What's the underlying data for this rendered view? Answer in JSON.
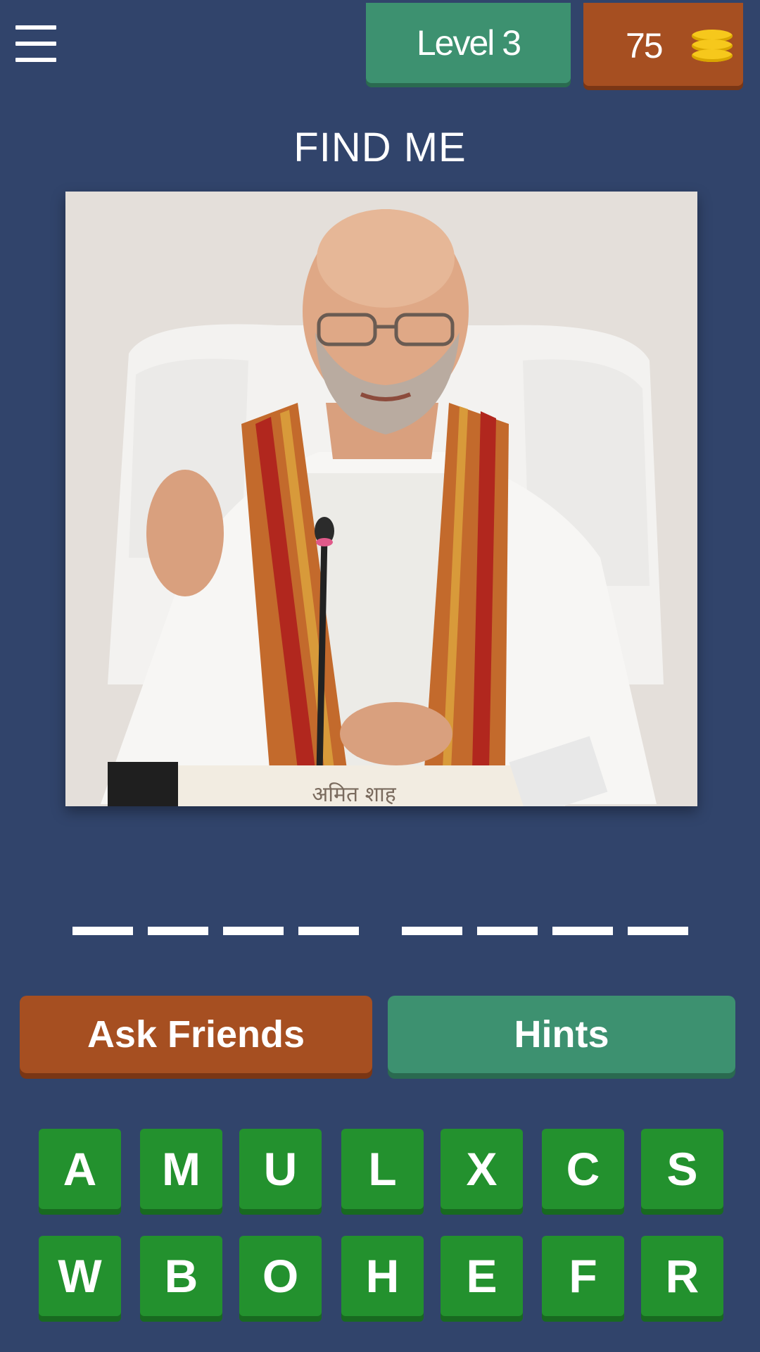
{
  "header": {
    "menu_icon": "hamburger-menu-icon",
    "level_label": "Level 3",
    "coins": "75",
    "coins_icon": "coin-stack-icon"
  },
  "title": "FIND ME",
  "photo": {
    "caption_text": "अमित शाह"
  },
  "answer": {
    "words": [
      4,
      4
    ]
  },
  "actions": {
    "ask_friends_label": "Ask Friends",
    "hints_label": "Hints"
  },
  "keyboard": {
    "rows": [
      [
        "A",
        "M",
        "U",
        "L",
        "X",
        "C",
        "S"
      ],
      [
        "W",
        "B",
        "O",
        "H",
        "E",
        "F",
        "R"
      ]
    ]
  },
  "colors": {
    "background": "#31446b",
    "green_button": "#3d9170",
    "orange_button": "#a64f21",
    "letter_key": "#23912e",
    "coin": "#f6c81c"
  }
}
